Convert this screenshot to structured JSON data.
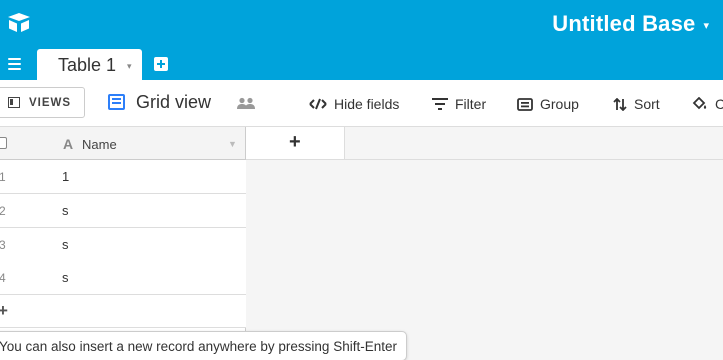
{
  "header": {
    "logo_icon": "airtable-logo-icon",
    "base_title": "Untitled Base",
    "base_title_caret": "▾",
    "menu_icon": "hamburger-icon",
    "tabs": [
      {
        "label": "Table 1",
        "caret": "▾"
      }
    ],
    "add_table_icon": "add-table-icon"
  },
  "viewbar": {
    "views_button_label": "VIEWS",
    "current_view_label": "Grid view",
    "toolbar": {
      "hide_fields": "Hide fields",
      "filter": "Filter",
      "group": "Group",
      "sort": "Sort",
      "color": "C"
    }
  },
  "grid": {
    "columns": [
      {
        "type_icon": "A",
        "name": "Name"
      }
    ],
    "add_column_label": "+",
    "rows": [
      {
        "num": "1",
        "name": "1"
      },
      {
        "num": "2",
        "name": "s"
      },
      {
        "num": "3",
        "name": "s"
      },
      {
        "num": "4",
        "name": "s"
      }
    ],
    "add_row_label": "+"
  },
  "tooltip": {
    "text": "You can also insert a new record anywhere by pressing Shift-Enter"
  },
  "colors": {
    "header_blue": "#00a3db",
    "grid_icon_blue": "#2d7ff9"
  }
}
